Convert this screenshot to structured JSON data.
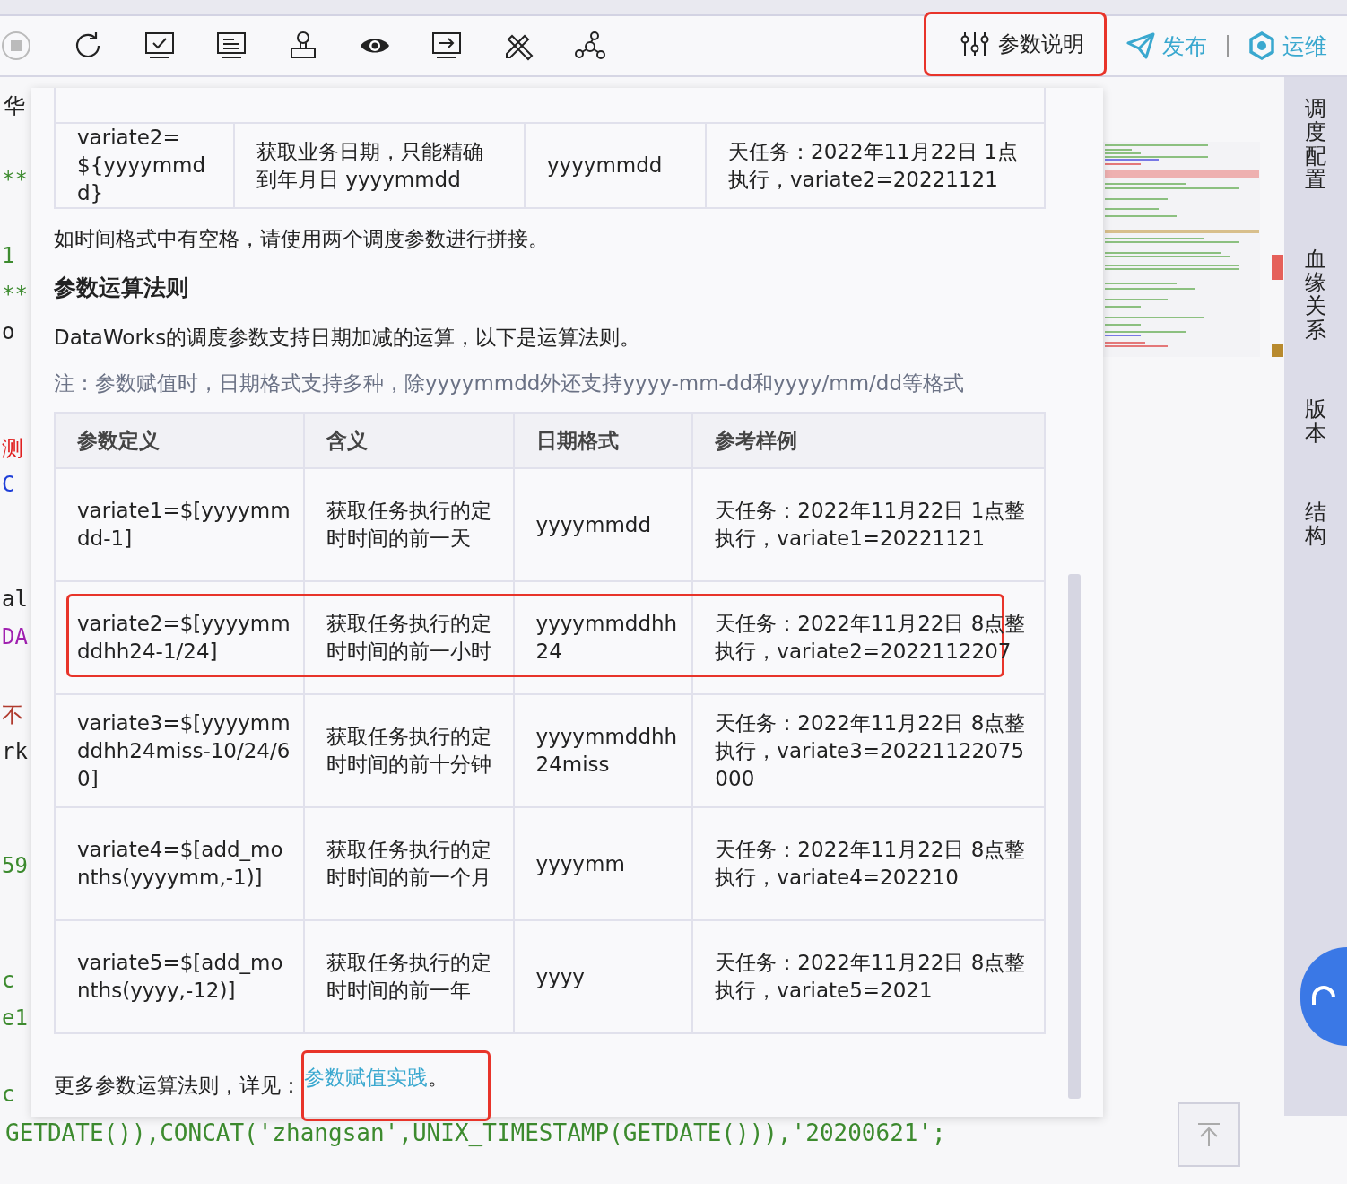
{
  "toolbar": {
    "param_button": {
      "label": "参数说明",
      "annotated": true
    },
    "publish_button": {
      "label": "发布"
    },
    "ops_button": {
      "label": "运维"
    }
  },
  "editor_tab": {
    "label": "华"
  },
  "code_fragments": [
    {
      "text": "**",
      "color": "#3d8b2f"
    },
    {
      "text": "1",
      "color": "#3d8b2f"
    },
    {
      "text": "**",
      "color": "#3d8b2f"
    },
    {
      "text": "o",
      "color": "#222222"
    },
    {
      "text": "测",
      "color": "#e02020"
    },
    {
      "text": "C",
      "color": "#1f3fd8"
    },
    {
      "text": "al",
      "color": "#222222"
    },
    {
      "text": "DA",
      "color": "#a020b0"
    },
    {
      "text": "不",
      "color": "#b03a2e"
    },
    {
      "text": "rk",
      "color": "#222222"
    },
    {
      "text": "59",
      "color": "#3d8b2f"
    },
    {
      "text": "c",
      "color": "#3d8b2f"
    },
    {
      "text": "e1",
      "color": "#3d8b2f"
    },
    {
      "text": "c",
      "color": "#3d8b2f"
    }
  ],
  "code_line": {
    "text": "GETDATE()),CONCAT('zhangsan',UNIX_TIMESTAMP(GETDATE())),'20200621';"
  },
  "panel": {
    "top_table": {
      "rows": [
        [
          "variate2=${yyyymmdd}",
          "获取业务日期，只能精确到年月日 yyyymmdd",
          "yyyymmdd",
          "天任务：2022年11月22日 1点执行，variate2=20221121"
        ]
      ]
    },
    "space_note": "如时间格式中有空格，请使用两个调度参数进行拼接。",
    "heading": "参数运算法则",
    "intro": "DataWorks的调度参数支持日期加减的运算，以下是运算法则。",
    "note": "注：参数赋值时，日期格式支持多种，除yyyymmdd外还支持yyyy-mm-dd和yyyy/mm/dd等格式",
    "table": {
      "columns": [
        "参数定义",
        "含义",
        "日期格式",
        "参考样例"
      ],
      "rows": [
        {
          "cells": [
            "variate1=$[yyyymmdd-1]",
            "获取任务执行的定时时间的前一天",
            "yyyymmdd",
            "天任务：2022年11月22日 1点整执行，variate1=20221121"
          ],
          "annotated": false
        },
        {
          "cells": [
            "variate2=$[yyyymmddhh24-1/24]",
            "获取任务执行的定时时间的前一小时",
            "yyyymmddhh24",
            "天任务：2022年11月22日 8点整执行，variate2=2022112207"
          ],
          "annotated": true
        },
        {
          "cells": [
            "variate3=$[yyyymmddhh24miss-10/24/60]",
            "获取任务执行的定时时间的前十分钟",
            "yyyymmddhh24miss",
            "天任务：2022年11月22日 8点整执行，variate3=20221122075000"
          ],
          "annotated": false
        },
        {
          "cells": [
            "variate4=$[add_months(yyyymm,-1)]",
            "获取任务执行的定时时间的前一个月",
            "yyyymm",
            "天任务：2022年11月22日 8点整执行，variate4=202210"
          ],
          "annotated": false
        },
        {
          "cells": [
            "variate5=$[add_months(yyyy,-12)]",
            "获取任务执行的定时时间的前一年",
            "yyyy",
            "天任务：2022年11月22日 8点整执行，variate5=2021"
          ],
          "annotated": false
        }
      ]
    },
    "more": {
      "text": "更多参数运算法则，详见：",
      "link": "参数赋值实践",
      "suffix": "。",
      "annotated": true
    }
  },
  "sidebar": {
    "items": [
      "调度配置",
      "血缘关系",
      "版本",
      "结构"
    ]
  }
}
